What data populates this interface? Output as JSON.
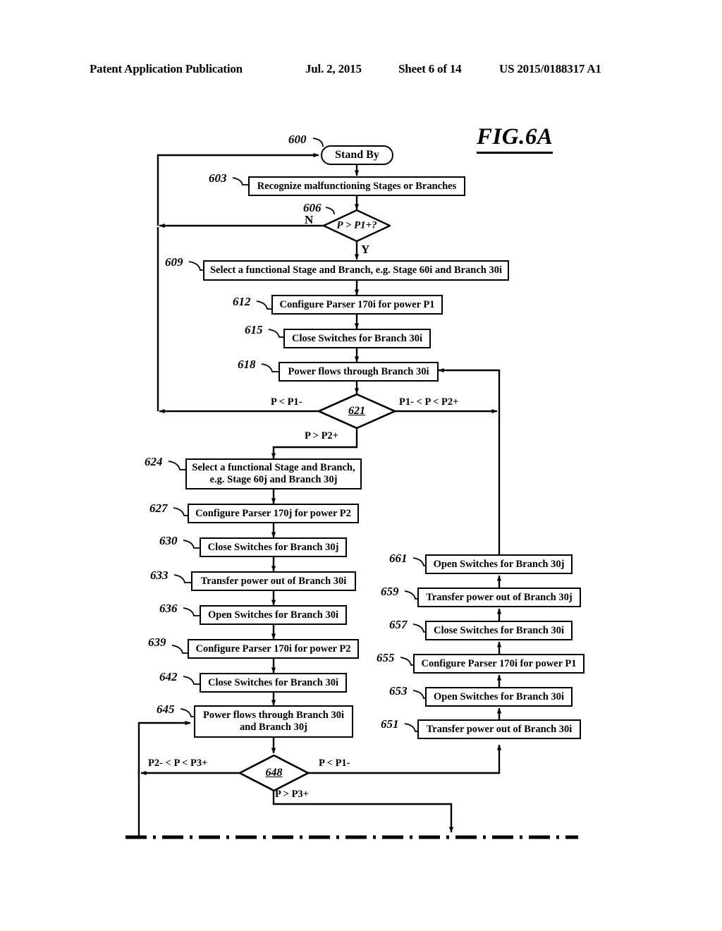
{
  "header": {
    "publication": "Patent Application Publication",
    "date": "Jul. 2, 2015",
    "sheet": "Sheet 6 of 14",
    "patent_number": "US 2015/0188317 A1"
  },
  "figure": {
    "title": "FIG.6A"
  },
  "nodes": {
    "n600": {
      "ref": "600",
      "text": "Stand By",
      "shape": "terminator"
    },
    "n603": {
      "ref": "603",
      "text": "Recognize malfunctioning Stages or Branches",
      "shape": "process"
    },
    "n606": {
      "ref": "606",
      "text": "P > P1+?",
      "shape": "decision"
    },
    "n609": {
      "ref": "609",
      "text": "Select a functional Stage and Branch, e.g. Stage 60i and Branch 30i",
      "shape": "process"
    },
    "n612": {
      "ref": "612",
      "text": "Configure Parser 170i for power P1",
      "shape": "process"
    },
    "n615": {
      "ref": "615",
      "text": "Close Switches for Branch 30i",
      "shape": "process"
    },
    "n618": {
      "ref": "618",
      "text": "Power flows through Branch 30i",
      "shape": "process"
    },
    "n621": {
      "ref": "621",
      "text": "621",
      "shape": "decision"
    },
    "n624": {
      "ref": "624",
      "text": "Select a functional Stage and Branch,\ne.g. Stage 60j and Branch 30j",
      "shape": "process"
    },
    "n627": {
      "ref": "627",
      "text": "Configure Parser 170j for power P2",
      "shape": "process"
    },
    "n630": {
      "ref": "630",
      "text": "Close Switches for Branch 30j",
      "shape": "process"
    },
    "n633": {
      "ref": "633",
      "text": "Transfer power out of Branch 30i",
      "shape": "process"
    },
    "n636": {
      "ref": "636",
      "text": "Open Switches for Branch 30i",
      "shape": "process"
    },
    "n639": {
      "ref": "639",
      "text": "Configure Parser 170i for power P2",
      "shape": "process"
    },
    "n642": {
      "ref": "642",
      "text": "Close Switches for Branch 30i",
      "shape": "process"
    },
    "n645": {
      "ref": "645",
      "text": "Power flows through Branch 30i\nand Branch 30j",
      "shape": "process"
    },
    "n648": {
      "ref": "648",
      "text": "648",
      "shape": "decision"
    },
    "n651": {
      "ref": "651",
      "text": "Transfer power out of Branch 30i",
      "shape": "process"
    },
    "n653": {
      "ref": "653",
      "text": "Open Switches for Branch 30i",
      "shape": "process"
    },
    "n655": {
      "ref": "655",
      "text": "Configure Parser 170i for power P1",
      "shape": "process"
    },
    "n657": {
      "ref": "657",
      "text": "Close Switches for Branch 30i",
      "shape": "process"
    },
    "n659": {
      "ref": "659",
      "text": "Transfer power out of Branch 30j",
      "shape": "process"
    },
    "n661": {
      "ref": "661",
      "text": "Open Switches for Branch 30j",
      "shape": "process"
    }
  },
  "edge_labels": {
    "e606_no": "N",
    "e606_yes": "Y",
    "e621_left": "P < P1-",
    "e621_right": "P1- < P < P2+",
    "e621_down": "P > P2+",
    "e648_left": "P2- < P < P3+",
    "e648_right": "P < P1-",
    "e648_down": "P > P3+"
  },
  "colors": {
    "ink": "#000000",
    "paper": "#ffffff"
  }
}
